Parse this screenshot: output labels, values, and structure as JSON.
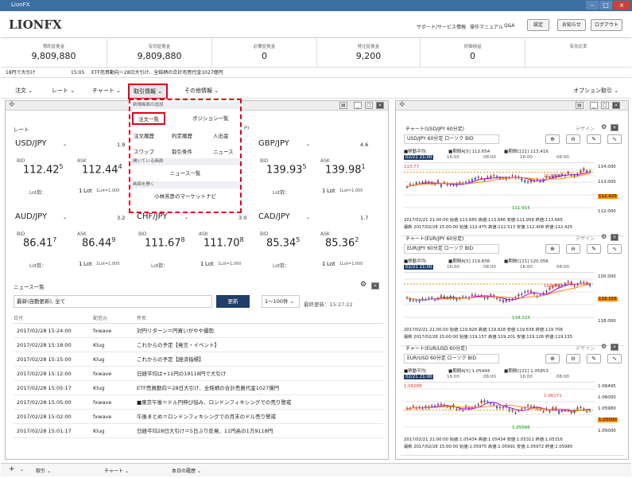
{
  "window": {
    "title": "LionFX"
  },
  "header": {
    "logo": "LIONFX",
    "links": [
      "サポート/サービス情報",
      "操作マニュアル",
      "Q&A"
    ],
    "buttons": [
      "設定",
      "お知らせ",
      "ログアウト"
    ]
  },
  "summary": [
    {
      "label": "預託証拠金",
      "value": "9,809,880"
    },
    {
      "label": "有効証拠金",
      "value": "9,809,880"
    },
    {
      "label": "必要証拠金",
      "value": "0"
    },
    {
      "label": "発注証拠金",
      "value": "9,200"
    },
    {
      "label": "評価損益",
      "value": "0"
    },
    {
      "label": "有効比率",
      "value": ""
    }
  ],
  "ticker": {
    "left": "18円で大引け",
    "time": "15:05",
    "text": "ETF売買動向＝28日大引け、全銘柄の合計売買代金1027億円"
  },
  "menu": {
    "items": [
      "注文",
      "レート",
      "チャート",
      "取引情報",
      "その他情報"
    ],
    "right": "オプション取引"
  },
  "dropdown": {
    "sec1": "新規画面の追加",
    "items1": [
      "注文一覧",
      "ポジション一覧",
      "注文履歴",
      "約定履歴",
      "入出金",
      "スワップ",
      "取引条件",
      "ニュース"
    ],
    "sec2": "開いている画面",
    "items2": [
      "ニュース一覧"
    ],
    "sec3": "画面を開く",
    "items3": [
      "小林芳彦のマーケットナビ"
    ]
  },
  "rates": {
    "title": "レート",
    "rsuffix": "P)",
    "items": [
      {
        "pair": "USD/JPY",
        "spread": "1.9",
        "bid_main": "112.42",
        "bid_sup": "5",
        "ask_main": "112.44",
        "ask_sup": "4"
      },
      {
        "pair": "",
        "spread": "",
        "bid_main": "",
        "bid_sup": "3",
        "ask_main": "",
        "ask_sup": "5"
      },
      {
        "pair": "GBP/JPY",
        "spread": "4.6",
        "bid_main": "139.93",
        "bid_sup": "5",
        "ask_main": "139.98",
        "ask_sup": "1"
      },
      {
        "pair": "AUD/JPY",
        "spread": "3.2",
        "bid_main": "86.41",
        "bid_sup": "7",
        "ask_main": "86.44",
        "ask_sup": "9"
      },
      {
        "pair": "CHF/JPY",
        "spread": "3.0",
        "bid_main": "111.67",
        "bid_sup": "8",
        "ask_main": "111.70",
        "ask_sup": "8"
      },
      {
        "pair": "CAD/JPY",
        "spread": "1.7",
        "bid_main": "85.34",
        "bid_sup": "5",
        "ask_main": "85.36",
        "ask_sup": "2"
      }
    ],
    "bid": "BID",
    "ask": "ASK",
    "lot": "Lot数：",
    "lotval": "1",
    "lotunit": "Lot",
    "lotnote": "1Lot=1,000"
  },
  "news": {
    "title": "ニュース一覧",
    "filter": "最新(自動更新), 全て",
    "update": "更新",
    "range": "1〜100件",
    "last": "最終更新：15:27:22",
    "cols": [
      "日付",
      "配信元",
      "件名"
    ],
    "rows": [
      {
        "date": "2017/02/28 15:24:00",
        "src": "fxwave",
        "subj": "対円リターン＝円買いがやや優勢"
      },
      {
        "date": "2017/02/28 15:18:00",
        "src": "Klug",
        "subj": "これからの予定【発言・イベント】"
      },
      {
        "date": "2017/02/28 15:15:00",
        "src": "Klug",
        "subj": "これからの予定【経済指標】"
      },
      {
        "date": "2017/02/28 15:12:00",
        "src": "fxwave",
        "subj": "日経平均は+11円の19118円で大引け"
      },
      {
        "date": "2017/02/28 15:05:17",
        "src": "Klug",
        "subj": "ETF売買動向＝28日大引け、全銘柄の合計売買代金1027億円"
      },
      {
        "date": "2017/02/28 15:05:00",
        "src": "fxwave",
        "subj": "■東京午後＝ドル円伸び悩み、ロンドンフィキシングでの売り警戒"
      },
      {
        "date": "2017/02/28 15:02:00",
        "src": "fxwave",
        "subj": "午後まとめ＝ロンドンフィキシングでの月末のドル売り警戒"
      },
      {
        "date": "2017/02/28 15:01:17",
        "src": "Klug",
        "subj": "日経平均28日大引け＝5日ぶり反発、11円高の1万9118円"
      }
    ]
  },
  "charts": [
    {
      "title": "チャート(USD/JPY 60分足)",
      "design": "デザイン",
      "sel": "USD/JPY 60分足 ローソク BID",
      "ma": "■移動平均:",
      "sma": "■期間A[5] 113.654",
      "smb": "■期間C[21] 113.416",
      "ts": "02/21 21:00",
      "times": [
        "16:00",
        "08:00",
        "16:00",
        "08:00"
      ],
      "y": [
        "114.000",
        "113.000",
        "112.425",
        "112.000"
      ],
      "hi": "112.830",
      "lo": "111.915",
      "mk": "113.77",
      "info1": "2017/02/21 21:00:00 始値:113.685 高値:113.686 安値:111.958 終値:113.665",
      "info2": "最新 2017/02/28 15:00:00 始値:112.475 高値:112.513 安値:112.408 終値:112.425"
    },
    {
      "title": "チャート(EUR/JPY 60分足)",
      "design": "デザイン",
      "sel": "EUR/JPY 60分足 ローソク BID",
      "ma": "■移動平均:",
      "sma": "■期間A[5] 119.836",
      "smb": "■期間C[21] 120.056",
      "ts": "02/21 21:00",
      "times": [
        "16:00",
        "08:00",
        "16:00",
        "08:00"
      ],
      "y": [
        "120.000",
        "119.155",
        "118.000"
      ],
      "hi": "119.450",
      "lo": "118.223",
      "mk": "",
      "info1": "2017/02/21 21:00:00 始値:119.828 高値:119.828 安値:119.638 終値:119.708",
      "info2": "最新 2017/02/28 15:00:00 始値:119.157 高値:119.201 安値:119.126 終値:119.155"
    },
    {
      "title": "チャート(EUR/USD 60分足)",
      "design": "デザイン",
      "sel": "EUR/USD 60分足 ローソク BID",
      "ma": "■移動平均:",
      "sma": "■期間A[5] 1.05444",
      "smb": "■期間C[21] 1.05853",
      "ts": "02/21 21:00",
      "times": [
        "16:00",
        "08:00",
        "16:00",
        "08:00"
      ],
      "y": [
        "1.06495",
        "1.06000",
        "1.05980",
        "1.05500",
        "1.05000"
      ],
      "hi": "1.06171",
      "lo": "1.05566",
      "mk": "1.06288",
      "info1": "2017/02/21 21:00:00 始値:1.05434 高値:1.05434 安値:1.05311 終値:1.05316",
      "info2": "最新 2017/02/28 15:00:00 始値:1.05975 高値:1.05991 安値:1.05972 終値:1.05980"
    }
  ],
  "bottom": {
    "tabs": [
      "取引",
      "チャート",
      "本日の履歴"
    ]
  }
}
